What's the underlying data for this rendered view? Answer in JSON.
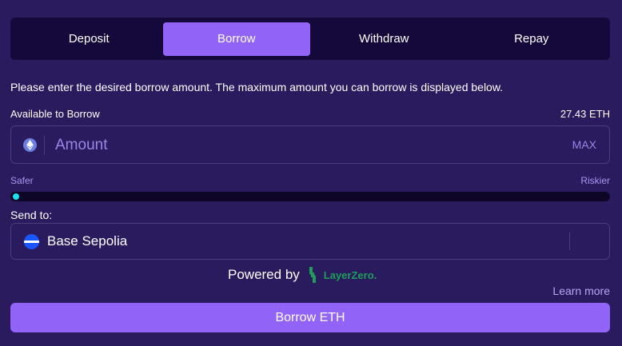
{
  "tabs": [
    {
      "label": "Deposit",
      "active": false
    },
    {
      "label": "Borrow",
      "active": true
    },
    {
      "label": "Withdraw",
      "active": false
    },
    {
      "label": "Repay",
      "active": false
    }
  ],
  "description": "Please enter the desired borrow amount. The maximum amount you can borrow is displayed below.",
  "available": {
    "label": "Available to Borrow",
    "value": "27.43 ETH"
  },
  "amount_field": {
    "placeholder": "Amount",
    "value": "",
    "token_icon": "ethereum-icon",
    "max_label": "MAX"
  },
  "risk": {
    "left_label": "Safer",
    "right_label": "Riskier",
    "level": 0
  },
  "send_to": {
    "label": "Send to:",
    "chain": "Base Sepolia",
    "chain_icon": "base-chain-icon"
  },
  "powered_by": {
    "label": "Powered by",
    "brand": "LayerZero.",
    "brand_color": "#1f9e5a"
  },
  "learn_more": "Learn more",
  "submit_label": "Borrow ETH",
  "colors": {
    "background": "#2a1a5e",
    "accent": "#9163f7",
    "slider_thumb": "#1ee0f0"
  }
}
